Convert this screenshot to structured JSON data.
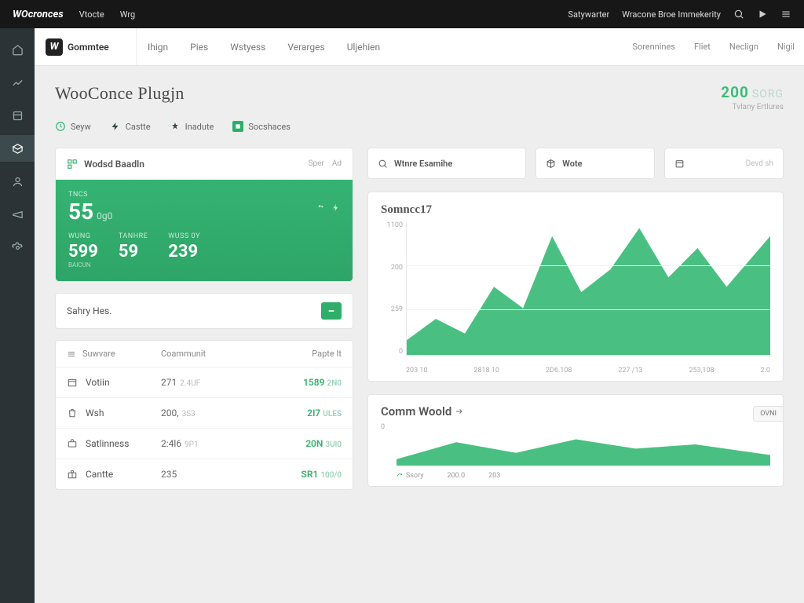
{
  "topbar": {
    "brand": "WOcronces",
    "nav": [
      "Vtocte",
      "Wrg"
    ],
    "right_links": [
      "Satywarter",
      "Wracone Broe Immekerity"
    ]
  },
  "sidebar": {
    "items": [
      "home",
      "analytics",
      "orders",
      "products",
      "customers",
      "marketing",
      "settings"
    ]
  },
  "apptabs": {
    "logo": "Gommtee",
    "tabs": [
      "Ihign",
      "Pies",
      "Wstyess",
      "Verarges",
      "Uljehien"
    ],
    "right": [
      "Sorennines",
      "Fliet",
      "Neclign",
      "Nigil"
    ]
  },
  "page": {
    "title": "WooConce Plugjn",
    "side_value": "200",
    "side_unit": "SORG",
    "side_sub": "Tvlany Ertlures"
  },
  "chips": [
    {
      "label": "Seyw",
      "kind": "green"
    },
    {
      "label": "Castte",
      "kind": "dark"
    },
    {
      "label": "Inadute",
      "kind": "dark"
    },
    {
      "label": "Socshaces",
      "kind": "fill"
    }
  ],
  "panel": {
    "title": "Wodsd Baadln",
    "links": [
      "Sper",
      "Ad"
    ],
    "top_label": "TNCS",
    "top_value": "55",
    "top_sup": "0g0",
    "cells": [
      {
        "label": "WUNG",
        "value": "599",
        "sub": "BAICUN"
      },
      {
        "label": "TANHRE",
        "value": "59",
        "sub": ""
      },
      {
        "label": "WUSS 0Y",
        "value": "239",
        "sub": ""
      }
    ]
  },
  "slim": {
    "label": "Sahry Hes.",
    "btn": "→"
  },
  "table": {
    "headers": [
      "Suwvare",
      "Coammunit",
      "Papte It"
    ],
    "rows": [
      {
        "icon": "box",
        "name": "Votiin",
        "v2": "271",
        "v2b": "2.4UF",
        "v3": "1589",
        "v3b": "2N0"
      },
      {
        "icon": "bag",
        "name": "Wsh",
        "v2": "200,",
        "v2b": "3S3",
        "v3": "2I7",
        "v3b": "ULES"
      },
      {
        "icon": "case",
        "name": "Satlinness",
        "v2": "2:4l6",
        "v2b": "9P1",
        "v3": "20N",
        "v3b": "3Ul0"
      },
      {
        "icon": "gift",
        "name": "Cantte",
        "v2": "235",
        "v2b": "",
        "v3": "SR1",
        "v3b": "100/0"
      }
    ]
  },
  "minicards": [
    {
      "icon": "search",
      "label": "Wtnre Esamihe"
    },
    {
      "icon": "cube",
      "label": "Wote"
    },
    {
      "icon": "calendar",
      "label": "",
      "extra": "Devd sh"
    }
  ],
  "chart1": {
    "title": "Somncc17"
  },
  "chart2": {
    "title": "Comm Woold",
    "tag": "OVNI"
  },
  "chart_data": [
    {
      "type": "area",
      "title": "Somncc17",
      "xlabel": "",
      "ylabel": "",
      "ylim": [
        0,
        1100
      ],
      "y_ticks": [
        0,
        259,
        200,
        1100
      ],
      "categories": [
        "203 10",
        "2818 10",
        "2D6.108",
        "227 /13",
        "253,108",
        "2.0"
      ],
      "values": [
        120,
        300,
        180,
        560,
        380,
        980,
        520,
        700,
        1050,
        640,
        880,
        560,
        980
      ]
    },
    {
      "type": "area",
      "title": "Comm Woold",
      "ylim": [
        0,
        1
      ],
      "y_ticks": [
        0
      ],
      "categories": [
        "Ssory",
        "200.0",
        "203"
      ],
      "values": [
        0.15,
        0.55,
        0.3,
        0.62,
        0.4,
        0.5,
        0.25
      ]
    }
  ]
}
